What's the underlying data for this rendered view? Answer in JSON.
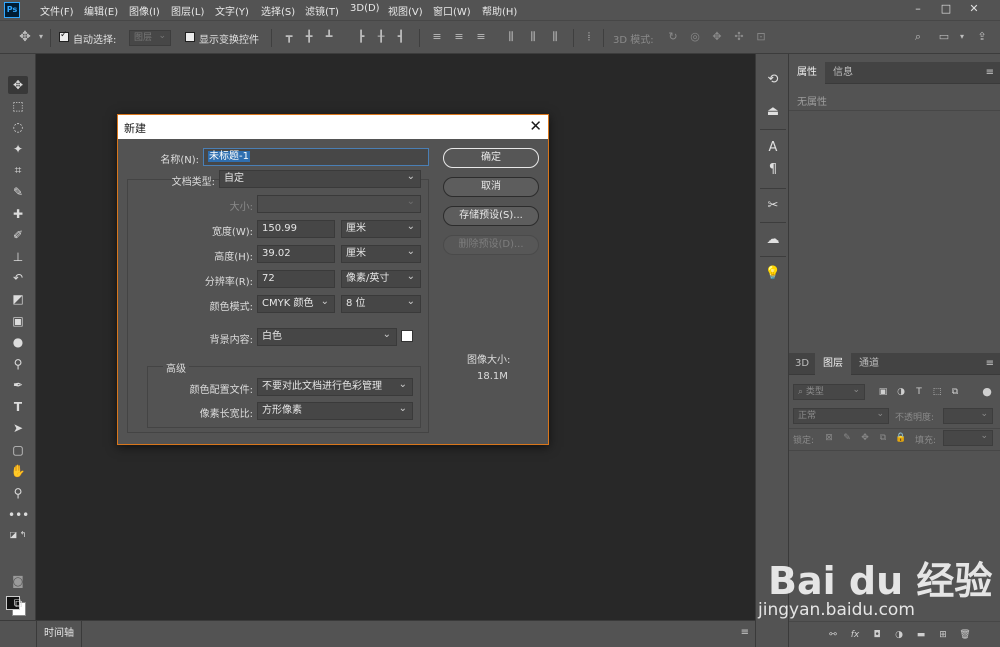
{
  "menubar": {
    "logo": "Ps",
    "items": [
      "文件(F)",
      "编辑(E)",
      "图像(I)",
      "图层(L)",
      "文字(Y)",
      "选择(S)",
      "滤镜(T)",
      "3D(D)",
      "视图(V)",
      "窗口(W)",
      "帮助(H)"
    ],
    "window_controls": [
      "–",
      "□",
      "✕"
    ]
  },
  "options": {
    "auto_select_label": "自动选择:",
    "auto_select_value": "图层",
    "show_transform_label": "显示变换控件",
    "mode_3d_label": "3D 模式:"
  },
  "timeline": {
    "tab": "时间轴"
  },
  "right_panel": {
    "top_tabs": [
      "属性",
      "信息"
    ],
    "properties_empty": "无属性",
    "bottom_tabs": [
      "3D",
      "图层",
      "通道"
    ],
    "kind_filter": "类型",
    "blend_mode": "正常",
    "opacity_label": "不透明度:",
    "lock_label": "锁定:",
    "fill_label": "填充:"
  },
  "dialog": {
    "title": "新建",
    "close": "✕",
    "name_label": "名称(N):",
    "name_value": "未标题-1",
    "doc_type_label": "文档类型:",
    "doc_type_value": "自定",
    "size_label": "大小:",
    "size_value": "",
    "width_label": "宽度(W):",
    "width_value": "150.99",
    "width_unit": "厘米",
    "height_label": "高度(H):",
    "height_value": "39.02",
    "height_unit": "厘米",
    "resolution_label": "分辨率(R):",
    "resolution_value": "72",
    "resolution_unit": "像素/英寸",
    "color_mode_label": "颜色模式:",
    "color_mode_value": "CMYK 颜色",
    "bit_depth_value": "8 位",
    "background_label": "背景内容:",
    "background_value": "白色",
    "advanced_label": "高级",
    "color_profile_label": "颜色配置文件:",
    "color_profile_value": "不要对此文档进行色彩管理",
    "pixel_aspect_label": "像素长宽比:",
    "pixel_aspect_value": "方形像素",
    "buttons": {
      "ok": "确定",
      "cancel": "取消",
      "save_preset": "存储预设(S)...",
      "delete_preset": "删除预设(D)..."
    },
    "image_size_label": "图像大小:",
    "image_size_value": "18.1M"
  },
  "watermark": {
    "text": "Bai du 经验",
    "url": "jingyan.baidu.com"
  },
  "colors": {
    "accent_border": "#d9761b",
    "selection": "#2f6fb0"
  }
}
